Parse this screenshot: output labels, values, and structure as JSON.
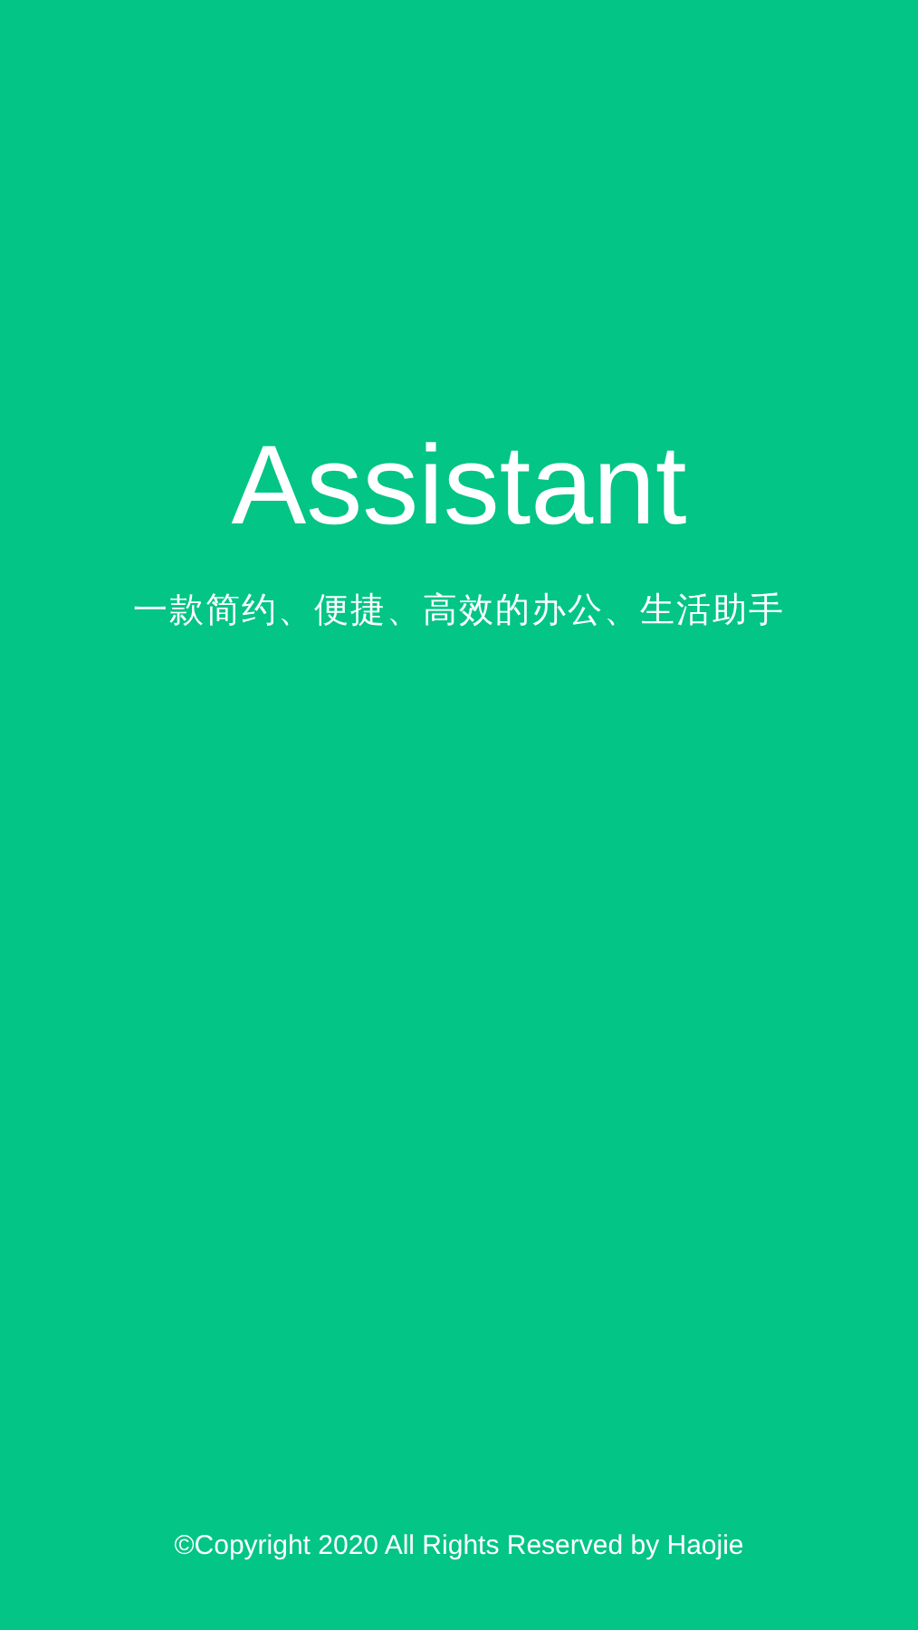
{
  "title": "Assistant",
  "subtitle": "一款简约、便捷、高效的办公、生活助手",
  "footer": "©Copyright 2020 All Rights Reserved by Haojie"
}
